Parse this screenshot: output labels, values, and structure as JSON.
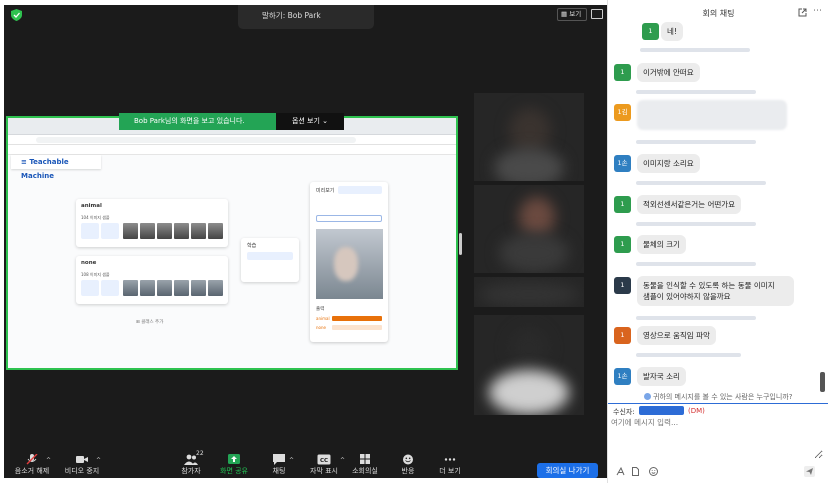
{
  "meeting": {
    "speaker_label": "말하기: Bob Park",
    "view_label": "보기",
    "share_banner": "Bob Park님의 화면을 보고 있습니다.",
    "options_label": "옵션 보기",
    "share_color": "#23a455",
    "shared_screen": {
      "app_title": "Teachable Machine",
      "classes": [
        {
          "name": "animal",
          "samples": "104 이미지 샘플"
        },
        {
          "name": "none",
          "samples": "108 이미지 샘플"
        }
      ],
      "add_class": "클래스 추가",
      "train_label": "학습",
      "preview_label": "미리보기",
      "output_label": "출력",
      "output_classes": [
        "animal",
        "none"
      ]
    }
  },
  "toolbar": {
    "items": [
      {
        "label": "음소거 해제",
        "icon": "mic-muted-icon"
      },
      {
        "label": "비디오 중지",
        "icon": "video-icon"
      },
      {
        "label": "참가자",
        "icon": "participants-icon",
        "badge": "22"
      },
      {
        "label": "화면 공유",
        "icon": "share-screen-icon"
      },
      {
        "label": "채팅",
        "icon": "chat-icon"
      },
      {
        "label": "자막 표시",
        "icon": "cc-icon"
      },
      {
        "label": "소회의실",
        "icon": "breakout-icon"
      },
      {
        "label": "반응",
        "icon": "reaction-icon"
      },
      {
        "label": "더 보기",
        "icon": "more-icon"
      }
    ],
    "leave_label": "회의실 나가기",
    "leave_color": "#1c6fe8"
  },
  "chat": {
    "title": "회의 채팅",
    "messages": [
      {
        "avatar": "1",
        "color": "#2e9c4e",
        "text": "네!"
      },
      {
        "avatar": "1",
        "color": "#2e9c4e",
        "text": "이거밖에 안떠요"
      },
      {
        "avatar": "1김",
        "color": "#ec9a1e",
        "text": ""
      },
      {
        "avatar": "1손",
        "color": "#2f7fc1",
        "text": "이미지랑 소리요"
      },
      {
        "avatar": "1",
        "color": "#2e9c4e",
        "text": "적외선센서같은거는 어떤가요"
      },
      {
        "avatar": "1",
        "color": "#2e9c4e",
        "text": "물체의 크기"
      },
      {
        "avatar": "1",
        "color": "#2b3a4a",
        "text": "동물을 인식할 수 있도록 하는 동물 이미지",
        "text2": "샘플이 있어야하지 않을까요"
      },
      {
        "avatar": "1",
        "color": "#d9641e",
        "text": "영상으로 움직임 파악"
      },
      {
        "avatar": "1손",
        "color": "#2f7fc1",
        "text": "발자국 소리"
      }
    ],
    "who_sees": "귀하의 메시지를 볼 수 있는 사람은 누구입니까?",
    "to_label": "수신자:",
    "dm_tag": "(DM)",
    "input_placeholder": "여기에 메시지 입력..."
  }
}
